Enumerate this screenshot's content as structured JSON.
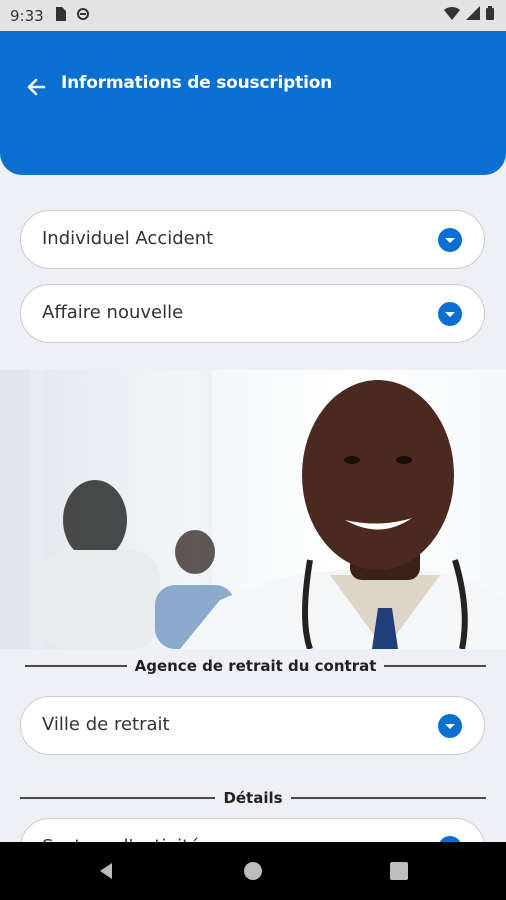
{
  "status_bar": {
    "time": "9:33"
  },
  "header": {
    "title": "Informations de souscription"
  },
  "selects": [
    {
      "label": "Individuel Accident"
    },
    {
      "label": "Affaire nouvelle"
    }
  ],
  "sections": {
    "agence": {
      "title": "Agence de retrait du contrat",
      "ville_placeholder": "Ville de retrait"
    },
    "details": {
      "title": "Détails",
      "partial_field": "Secteur d'activité"
    }
  },
  "colors": {
    "primary": "#0a6fd0",
    "background": "#eef0f5"
  },
  "icons": {
    "back": "arrow-left-icon",
    "dropdown": "chevron-down-circle-icon"
  }
}
